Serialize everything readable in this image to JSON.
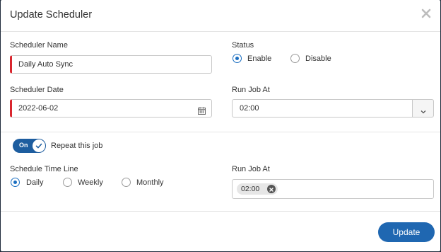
{
  "dialog": {
    "title": "Update Scheduler"
  },
  "form": {
    "scheduler_name": {
      "label": "Scheduler Name",
      "value": "Daily Auto Sync"
    },
    "status": {
      "label": "Status",
      "options": [
        "Enable",
        "Disable"
      ],
      "selected": "Enable"
    },
    "scheduler_date": {
      "label": "Scheduler Date",
      "value": "2022-06-02"
    },
    "run_job_at": {
      "label": "Run Job At",
      "value": "02:00"
    },
    "repeat": {
      "toggle_text": "On",
      "label": "Repeat this job",
      "checked": true
    },
    "timeline": {
      "label": "Schedule Time Line",
      "options": [
        "Daily",
        "Weekly",
        "Monthly"
      ],
      "selected": "Daily"
    },
    "run_job_at_multi": {
      "label": "Run Job At",
      "chips": [
        "02:00"
      ]
    }
  },
  "footer": {
    "update_label": "Update"
  },
  "colors": {
    "primary": "#1f67b1",
    "required": "#d9262e",
    "toggle": "#1d5d9f"
  }
}
